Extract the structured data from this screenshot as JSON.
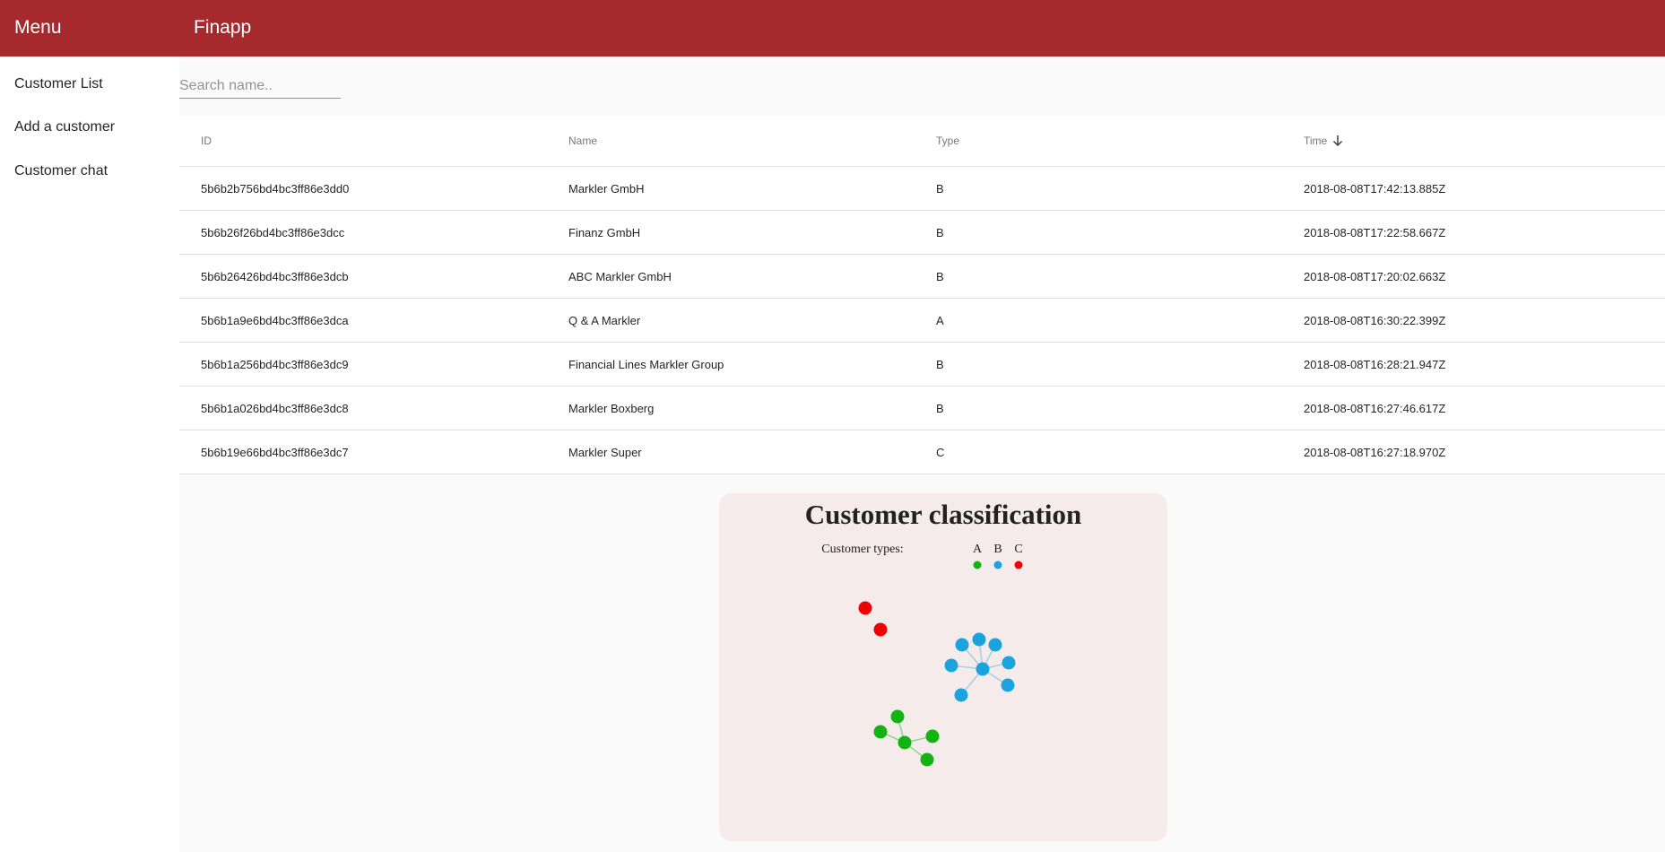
{
  "header": {
    "menu_label": "Menu",
    "app_title": "Finapp"
  },
  "sidebar": {
    "items": [
      {
        "label": "Customer List"
      },
      {
        "label": "Add a customer"
      },
      {
        "label": "Customer chat"
      }
    ]
  },
  "search": {
    "placeholder": "Search name.."
  },
  "table": {
    "columns": [
      "ID",
      "Name",
      "Type",
      "Time"
    ],
    "sort_column": "Time",
    "sort_direction": "descending",
    "rows": [
      {
        "id": "5b6b2b756bd4bc3ff86e3dd0",
        "name": "Markler GmbH",
        "type": "B",
        "time": "2018-08-08T17:42:13.885Z"
      },
      {
        "id": "5b6b26f26bd4bc3ff86e3dcc",
        "name": "Finanz GmbH",
        "type": "B",
        "time": "2018-08-08T17:22:58.667Z"
      },
      {
        "id": "5b6b26426bd4bc3ff86e3dcb",
        "name": "ABC Markler GmbH",
        "type": "B",
        "time": "2018-08-08T17:20:02.663Z"
      },
      {
        "id": "5b6b1a9e6bd4bc3ff86e3dca",
        "name": "Q & A Markler",
        "type": "A",
        "time": "2018-08-08T16:30:22.399Z"
      },
      {
        "id": "5b6b1a256bd4bc3ff86e3dc9",
        "name": "Financial Lines Markler Group",
        "type": "B",
        "time": "2018-08-08T16:28:21.947Z"
      },
      {
        "id": "5b6b1a026bd4bc3ff86e3dc8",
        "name": "Markler Boxberg",
        "type": "B",
        "time": "2018-08-08T16:27:46.617Z"
      },
      {
        "id": "5b6b19e66bd4bc3ff86e3dc7",
        "name": "Markler Super",
        "type": "C",
        "time": "2018-08-08T16:27:18.970Z"
      }
    ]
  },
  "classification": {
    "title": "Customer classification",
    "legend_label": "Customer types:",
    "types": [
      {
        "label": "A",
        "color": "#12b312"
      },
      {
        "label": "B",
        "color": "#1aa3dc"
      },
      {
        "label": "C",
        "color": "#f00000"
      }
    ]
  },
  "colors": {
    "header_bg": "#a6292d",
    "card_bg": "#f5ebeb"
  }
}
